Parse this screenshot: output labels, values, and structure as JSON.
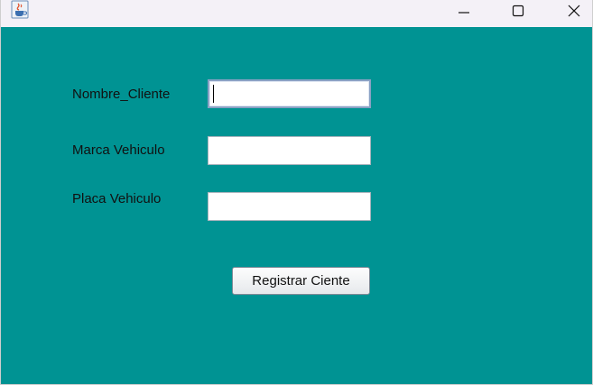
{
  "window": {
    "app_icon": "java-cup-icon",
    "controls": {
      "minimize_icon": "minimize-icon",
      "maximize_icon": "maximize-icon",
      "close_icon": "close-icon"
    }
  },
  "colors": {
    "background": "#009393",
    "titlebar": "#f4f1f7"
  },
  "form": {
    "nombre_label": "Nombre_Cliente",
    "nombre_value": "",
    "marca_label": "Marca Vehiculo",
    "marca_value": "",
    "placa_label": "Placa Vehiculo",
    "placa_value": "",
    "submit_label": "Registrar Ciente"
  }
}
